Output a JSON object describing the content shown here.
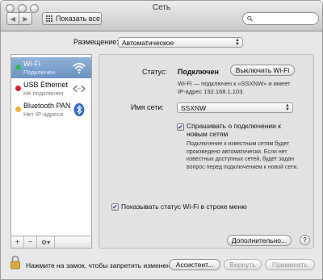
{
  "window": {
    "title": "Сеть"
  },
  "toolbar": {
    "back_label": "◀",
    "forward_label": "▶",
    "show_all_label": "Показать все",
    "search_placeholder": ""
  },
  "placement": {
    "label": "Размещение:",
    "value": "Автоматическое"
  },
  "services": [
    {
      "name": "Wi-Fi",
      "status": "Подключен",
      "dot_color": "#39b54a",
      "icon": "wifi-icon",
      "selected": true
    },
    {
      "name": "USB Ethernet",
      "status": "Не подключен",
      "dot_color": "#d9262c",
      "icon": "ethernet-arrows-icon",
      "selected": false
    },
    {
      "name": "Bluetooth PAN",
      "status": "Нет IP-адреса",
      "dot_color": "#f0b429",
      "icon": "bluetooth-icon",
      "selected": false
    }
  ],
  "list_controls": {
    "add": "+",
    "remove": "−",
    "gear": "⚙▾"
  },
  "detail": {
    "status_label": "Статус:",
    "status_value": "Подключен",
    "toggle_button": "Выключить Wi-Fi",
    "status_desc": "Wi-Fi — подключен к «SSXNW» и имеет IP-адрес 192.168.1.103.",
    "network_label": "Имя сети:",
    "network_value": "SSXNW",
    "ask_checkbox_label": "Спрашивать о подключении к новым сетям",
    "ask_checkbox_checked": true,
    "ask_desc": "Подключение к известным сетям будет произведено автоматически. Если нет известных доступных сетей, будет задан вопрос перед подключением к новой сети.",
    "menu_checkbox_label": "Показывать статус Wi-Fi в строке меню",
    "menu_checkbox_checked": true,
    "advanced_button": "Дополнительно...",
    "help_label": "?"
  },
  "footer": {
    "lock_text": "Нажмите на замок, чтобы запретить изменения.",
    "assistant_button": "Ассистент...",
    "revert_button": "Вернуть",
    "apply_button": "Применить"
  },
  "colors": {
    "selection": "#7aa0cc",
    "checkmark": "#1a3d8f",
    "dot_green": "#39b54a",
    "dot_red": "#d9262c",
    "dot_yellow": "#f0b429"
  }
}
